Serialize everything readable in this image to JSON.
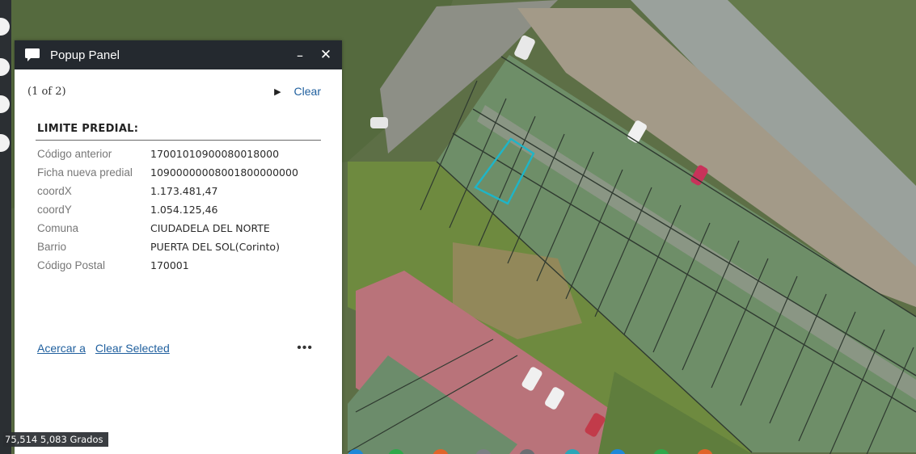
{
  "popup": {
    "title": "Popup Panel",
    "minimize_glyph": "–",
    "close_glyph": "✕",
    "pager": "(1 of 2)",
    "next_glyph": "▶",
    "clear_label": "Clear",
    "section_title": "LIMITE PREDIAL:",
    "attributes": [
      {
        "key": "Código anterior",
        "value": "17001010900080018000"
      },
      {
        "key": "Ficha nueva predial",
        "value": "10900000008001800000000"
      },
      {
        "key": "coordX",
        "value": "1.173.481,47"
      },
      {
        "key": "coordY",
        "value": "1.054.125,46"
      },
      {
        "key": "Comuna",
        "value": "CIUDADELA DEL NORTE"
      },
      {
        "key": "Barrio",
        "value": "PUERTA DEL SOL(Corinto)"
      },
      {
        "key": "Código Postal",
        "value": "170001"
      }
    ],
    "actions": {
      "zoom_to": "Acercar a",
      "clear_selected": "Clear Selected",
      "more": "•••"
    }
  },
  "map": {
    "coord_readout": "75,514 5,083 Grados",
    "selection_color": "#1fb5c7",
    "icons": [
      "chat-icon",
      "minimize-icon",
      "close-icon",
      "next-arrow-icon",
      "more-icon"
    ]
  }
}
